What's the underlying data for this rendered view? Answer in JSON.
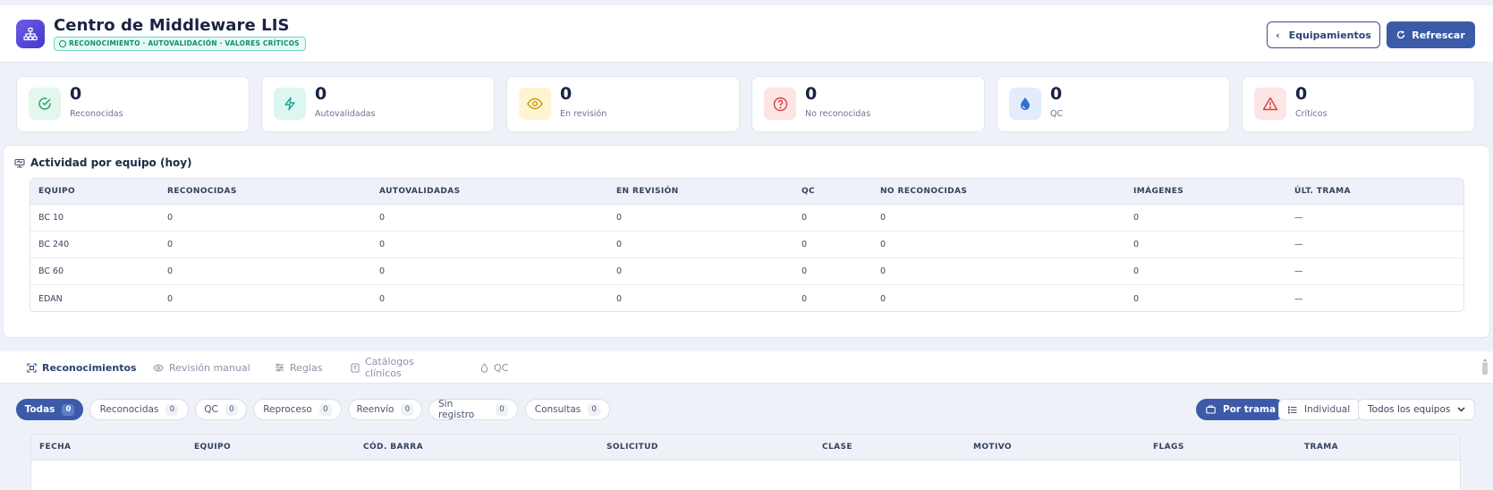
{
  "header": {
    "title": "Centro de Middleware LIS",
    "badge": "RECONOCIMIENTO · AUTOVALIDACIÓN · VALORES CRÍTICOS",
    "equipment_button": "Equipamientos",
    "refresh_button": "Refrescar"
  },
  "stats": [
    {
      "value": "0",
      "label": "Reconocidas",
      "icon": "check-circle-icon",
      "color": "#1f9e64",
      "bg": "#e3f7ec"
    },
    {
      "value": "0",
      "label": "Autovalidadas",
      "icon": "lightning-icon",
      "color": "#1aa38f",
      "bg": "#dcf6f1"
    },
    {
      "value": "0",
      "label": "En revisión",
      "icon": "eye-icon",
      "color": "#c99a12",
      "bg": "#fdf4d2"
    },
    {
      "value": "0",
      "label": "No reconocidas",
      "icon": "question-circle-icon",
      "color": "#d04444",
      "bg": "#fde5e5"
    },
    {
      "value": "0",
      "label": "QC",
      "icon": "droplet-icon",
      "color": "#2f6fd6",
      "bg": "#e2ecfc"
    },
    {
      "value": "0",
      "label": "Críticos",
      "icon": "warning-triangle-icon",
      "color": "#d04444",
      "bg": "#fde5e5"
    }
  ],
  "activity": {
    "title": "Actividad por equipo (hoy)",
    "columns": [
      "EQUIPO",
      "RECONOCIDAS",
      "AUTOVALIDADAS",
      "EN REVISIÓN",
      "QC",
      "NO RECONOCIDAS",
      "IMÁGENES",
      "ÚLT. TRAMA"
    ],
    "rows": [
      [
        "BC 10",
        "0",
        "0",
        "0",
        "0",
        "0",
        "0",
        "—"
      ],
      [
        "BC 240",
        "0",
        "0",
        "0",
        "0",
        "0",
        "0",
        "—"
      ],
      [
        "BC 60",
        "0",
        "0",
        "0",
        "0",
        "0",
        "0",
        "—"
      ],
      [
        "EDAN",
        "0",
        "0",
        "0",
        "0",
        "0",
        "0",
        "—"
      ]
    ]
  },
  "tabs": [
    {
      "label": "Reconocimientos",
      "icon": "scan-icon",
      "active": true
    },
    {
      "label": "Revisión manual",
      "icon": "eye-icon",
      "active": false
    },
    {
      "label": "Reglas",
      "icon": "sliders-icon",
      "active": false
    },
    {
      "label": "Catálogos clínicos",
      "icon": "book-icon",
      "active": false
    },
    {
      "label": "QC",
      "icon": "droplet-icon",
      "active": false
    }
  ],
  "filters": [
    {
      "label": "Todas",
      "count": "0",
      "active": true
    },
    {
      "label": "Reconocidas",
      "count": "0",
      "active": false
    },
    {
      "label": "QC",
      "count": "0",
      "active": false
    },
    {
      "label": "Reproceso",
      "count": "0",
      "active": false
    },
    {
      "label": "Reenvío",
      "count": "0",
      "active": false
    },
    {
      "label": "Sin registro",
      "count": "0",
      "active": false
    },
    {
      "label": "Consultas",
      "count": "0",
      "active": false
    }
  ],
  "view_modes": {
    "by_frame": "Por trama",
    "individual": "Individual"
  },
  "equipment_select": "Todos los equipos",
  "results_table": {
    "columns": [
      "FECHA",
      "EQUIPO",
      "CÓD. BARRA",
      "SOLICITUD",
      "CLASE",
      "MOTIVO",
      "FLAGS",
      "TRAMA"
    ]
  }
}
